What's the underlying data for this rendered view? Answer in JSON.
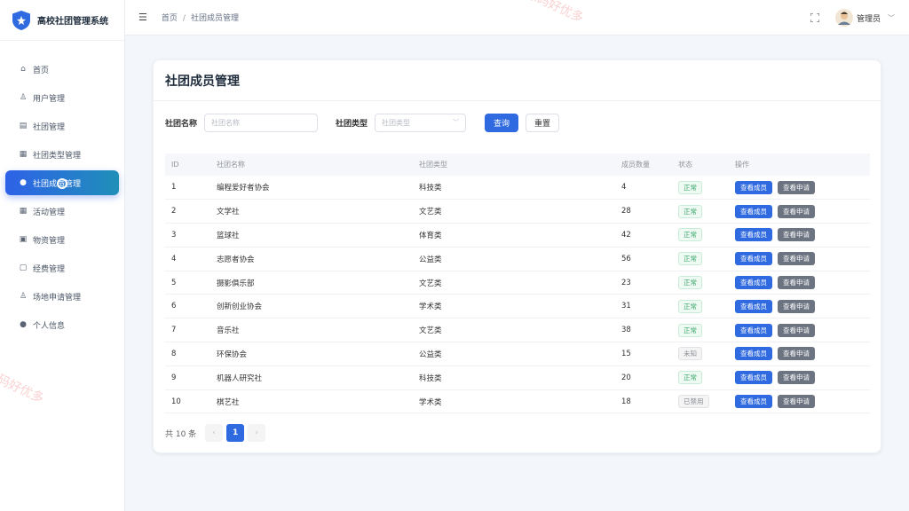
{
  "app": {
    "title": "高校社团管理系统"
  },
  "sidebar": {
    "items": [
      {
        "label": "首页",
        "icon": "home-icon",
        "active": false
      },
      {
        "label": "用户管理",
        "icon": "user-icon",
        "active": false
      },
      {
        "label": "社团管理",
        "icon": "document-icon",
        "active": false
      },
      {
        "label": "社团类型管理",
        "icon": "grid-icon",
        "active": false
      },
      {
        "label": "社团成员管理",
        "icon": "person-icon",
        "active": true
      },
      {
        "label": "活动管理",
        "icon": "calendar-icon",
        "active": false
      },
      {
        "label": "物资管理",
        "icon": "box-icon",
        "active": false
      },
      {
        "label": "经费管理",
        "icon": "money-icon",
        "active": false
      },
      {
        "label": "场地申请管理",
        "icon": "person-outline-icon",
        "active": false
      },
      {
        "label": "个人信息",
        "icon": "profile-icon",
        "active": false
      }
    ]
  },
  "header": {
    "breadcrumb": [
      "首页",
      "社团成员管理"
    ],
    "user_name": "管理员"
  },
  "watermark": "源码好优多",
  "main": {
    "title": "社团成员管理",
    "filters": {
      "name_label": "社团名称",
      "name_placeholder": "社团名称",
      "type_label": "社团类型",
      "type_placeholder": "社团类型",
      "query_label": "查询",
      "reset_label": "重置"
    },
    "table": {
      "columns": [
        "ID",
        "社团名称",
        "社团类型",
        "成员数量",
        "状态",
        "操作"
      ],
      "rows": [
        {
          "id": "1",
          "name": "编程爱好者协会",
          "type": "科技类",
          "count": "4",
          "status": "正常",
          "status_kind": "ok"
        },
        {
          "id": "2",
          "name": "文学社",
          "type": "文艺类",
          "count": "28",
          "status": "正常",
          "status_kind": "ok"
        },
        {
          "id": "3",
          "name": "篮球社",
          "type": "体育类",
          "count": "42",
          "status": "正常",
          "status_kind": "ok"
        },
        {
          "id": "4",
          "name": "志愿者协会",
          "type": "公益类",
          "count": "56",
          "status": "正常",
          "status_kind": "ok"
        },
        {
          "id": "5",
          "name": "摄影俱乐部",
          "type": "文艺类",
          "count": "23",
          "status": "正常",
          "status_kind": "ok"
        },
        {
          "id": "6",
          "name": "创新创业协会",
          "type": "学术类",
          "count": "31",
          "status": "正常",
          "status_kind": "ok"
        },
        {
          "id": "7",
          "name": "音乐社",
          "type": "文艺类",
          "count": "38",
          "status": "正常",
          "status_kind": "ok"
        },
        {
          "id": "8",
          "name": "环保协会",
          "type": "公益类",
          "count": "15",
          "status": "未知",
          "status_kind": "grey"
        },
        {
          "id": "9",
          "name": "机器人研究社",
          "type": "科技类",
          "count": "20",
          "status": "正常",
          "status_kind": "ok"
        },
        {
          "id": "10",
          "name": "棋艺社",
          "type": "学术类",
          "count": "18",
          "status": "已禁用",
          "status_kind": "grey"
        }
      ],
      "op_members": "查看成员",
      "op_apply": "查看申请"
    },
    "pagination": {
      "total": "共 10 条",
      "current": "1"
    }
  },
  "colors": {
    "primary": "#2f6ae0",
    "ok": "#3aa66a",
    "grey_btn": "#6b7480"
  }
}
